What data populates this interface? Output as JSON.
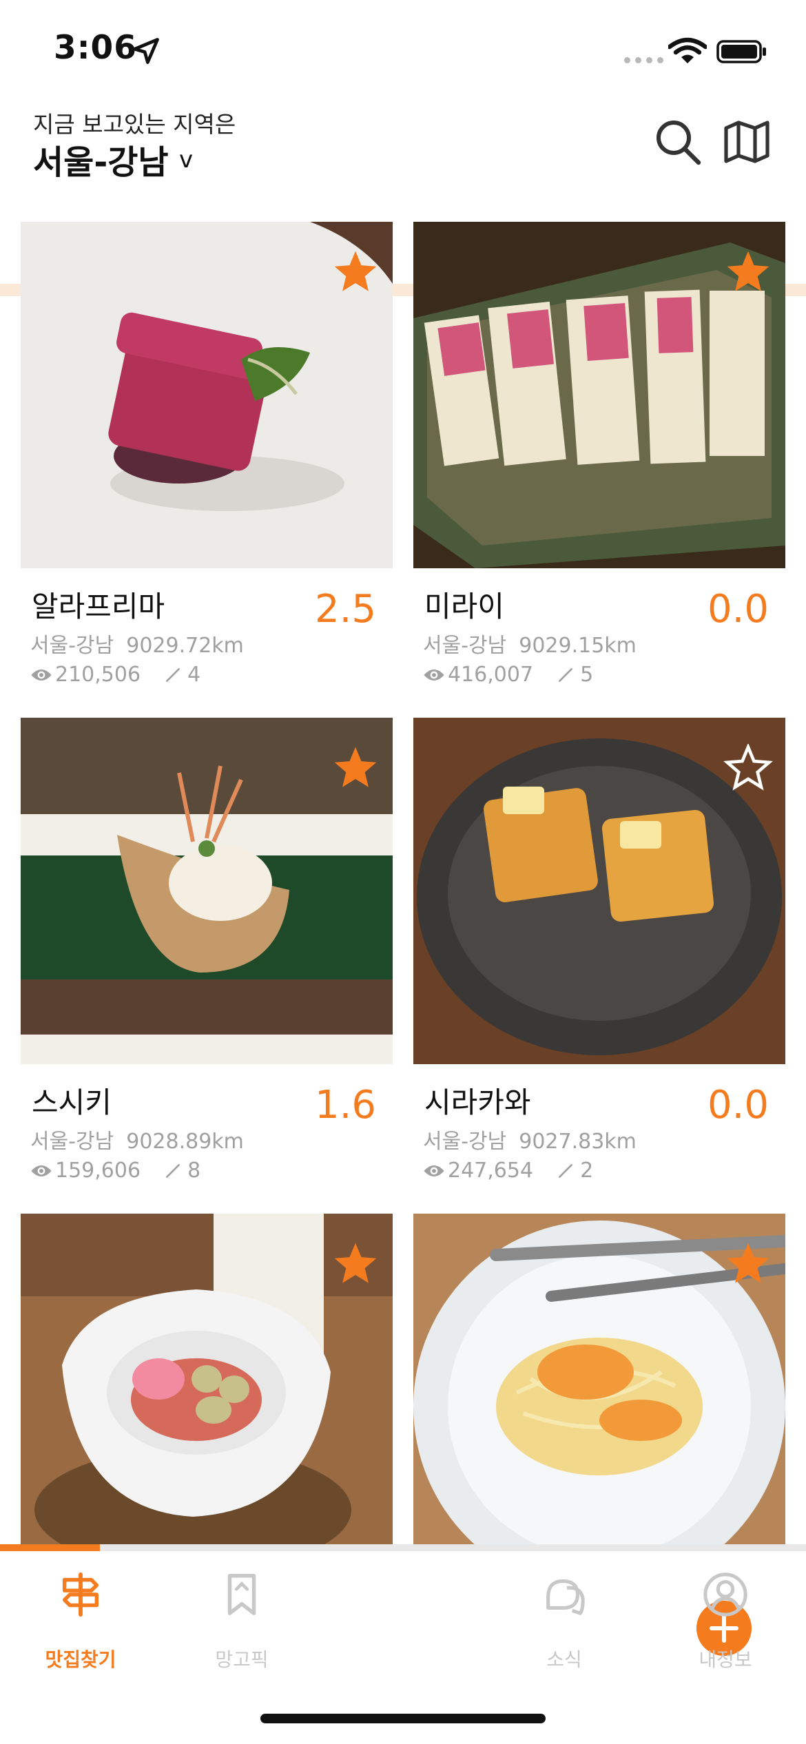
{
  "status_bar": {
    "time": "3:06"
  },
  "header": {
    "region_caption": "지금 보고있는 지역은",
    "region_name": "서울-강남",
    "region_chevron": "v",
    "icons": [
      "search-icon",
      "map-icon"
    ]
  },
  "restaurants": [
    {
      "name": "알라프리마",
      "rating": "2.5",
      "region": "서울-강남",
      "distance": "9029.72km",
      "views": "210,506",
      "reviews": "4",
      "favorited": true
    },
    {
      "name": "미라이",
      "rating": "0.0",
      "region": "서울-강남",
      "distance": "9029.15km",
      "views": "416,007",
      "reviews": "5",
      "favorited": true
    },
    {
      "name": "스시키",
      "rating": "1.6",
      "region": "서울-강남",
      "distance": "9028.89km",
      "views": "159,606",
      "reviews": "8",
      "favorited": true
    },
    {
      "name": "시라카와",
      "rating": "0.0",
      "region": "서울-강남",
      "distance": "9027.83km",
      "views": "247,654",
      "reviews": "2",
      "favorited": false
    },
    {
      "favorited": true
    },
    {
      "favorited": true
    }
  ],
  "scroll_progress": 0.124,
  "tabs": [
    {
      "label": "맛집찾기",
      "icon": "signpost-icon",
      "active": true
    },
    {
      "label": "망고픽",
      "icon": "bookmark-icon",
      "active": false
    },
    {
      "label": "",
      "icon": "plus-icon",
      "active": false
    },
    {
      "label": "소식",
      "icon": "chat-icon",
      "active": false
    },
    {
      "label": "내정보",
      "icon": "profile-icon",
      "active": false
    }
  ],
  "colors": {
    "accent": "#f47b1e",
    "muted": "#a0a0a0",
    "inactive": "#c8c8c8"
  }
}
